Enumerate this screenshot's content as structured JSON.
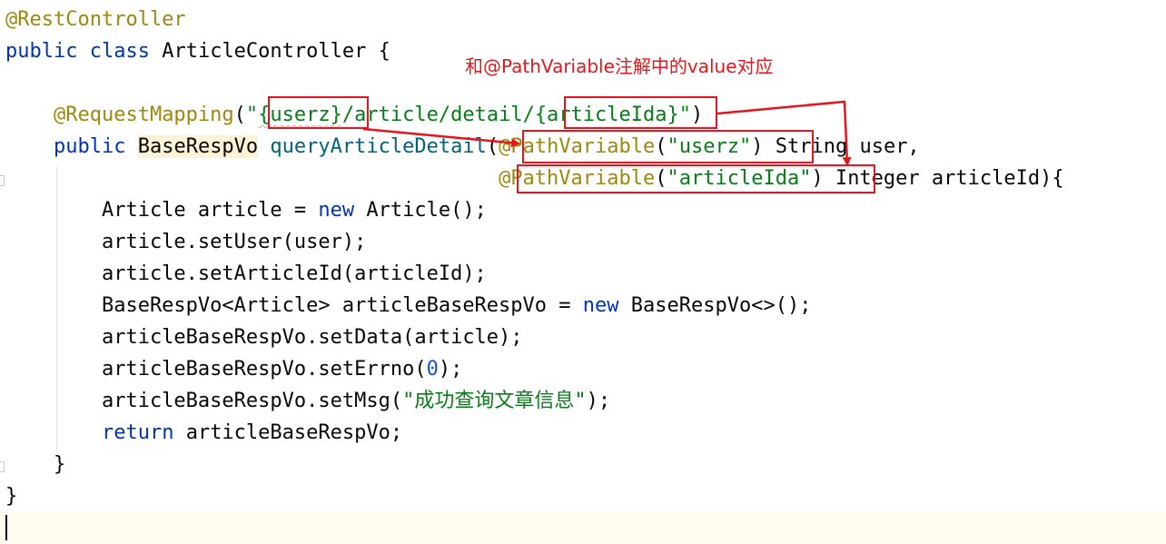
{
  "editor": {
    "lines": [
      {
        "id": "l1",
        "tokens": [
          {
            "t": "@RestController",
            "c": "ann"
          }
        ]
      },
      {
        "id": "l2",
        "tokens": [
          {
            "t": "public",
            "c": "kw"
          },
          {
            "t": " "
          },
          {
            "t": "class",
            "c": "kw"
          },
          {
            "t": " ArticleController {"
          }
        ]
      },
      {
        "id": "l3",
        "tokens": []
      },
      {
        "id": "l4",
        "tokens": [
          {
            "t": "    "
          },
          {
            "t": "@RequestMapping",
            "c": "ann"
          },
          {
            "t": "("
          },
          {
            "t": "\"",
            "c": "str"
          },
          {
            "t": "{userz}",
            "c": "str wavy"
          },
          {
            "t": "/article/detail/",
            "c": "str"
          },
          {
            "t": "{articleIda}",
            "c": "str"
          },
          {
            "t": "\"",
            "c": "str"
          },
          {
            "t": ")"
          }
        ]
      },
      {
        "id": "l5",
        "tokens": [
          {
            "t": "    "
          },
          {
            "t": "public",
            "c": "kw"
          },
          {
            "t": " "
          },
          {
            "t": "BaseRespVo",
            "c": "hl"
          },
          {
            "t": " "
          },
          {
            "t": "queryArticleDetail",
            "c": "method"
          },
          {
            "t": "("
          },
          {
            "t": "@PathVariable",
            "c": "ann"
          },
          {
            "t": "("
          },
          {
            "t": "\"userz\"",
            "c": "str"
          },
          {
            "t": ") String user,"
          }
        ]
      },
      {
        "id": "l6",
        "tokens": [
          {
            "t": "                                         "
          },
          {
            "t": "@PathVariable",
            "c": "ann"
          },
          {
            "t": "("
          },
          {
            "t": "\"articleIda\"",
            "c": "str"
          },
          {
            "t": ") Integer articleId){"
          }
        ]
      },
      {
        "id": "l7",
        "tokens": [
          {
            "t": "        Article article = "
          },
          {
            "t": "new",
            "c": "kw"
          },
          {
            "t": " Article();"
          }
        ]
      },
      {
        "id": "l8",
        "tokens": [
          {
            "t": "        article.setUser(user);"
          }
        ]
      },
      {
        "id": "l9",
        "tokens": [
          {
            "t": "        article.setArticleId(articleId);"
          }
        ]
      },
      {
        "id": "l10",
        "tokens": [
          {
            "t": "        BaseRespVo<Article> articleBaseRespVo = "
          },
          {
            "t": "new",
            "c": "kw"
          },
          {
            "t": " BaseRespVo<>();"
          }
        ]
      },
      {
        "id": "l11",
        "tokens": [
          {
            "t": "        articleBaseRespVo.setData(article);"
          }
        ]
      },
      {
        "id": "l12",
        "tokens": [
          {
            "t": "        articleBaseRespVo.setErrno("
          },
          {
            "t": "0",
            "c": "num"
          },
          {
            "t": ");"
          }
        ]
      },
      {
        "id": "l13",
        "tokens": [
          {
            "t": "        articleBaseRespVo.setMsg("
          },
          {
            "t": "\"成功查询文章信息\"",
            "c": "str"
          },
          {
            "t": ");"
          }
        ]
      },
      {
        "id": "l14",
        "tokens": [
          {
            "t": "        "
          },
          {
            "t": "return",
            "c": "kw"
          },
          {
            "t": " articleBaseRespVo;"
          }
        ]
      },
      {
        "id": "l15",
        "tokens": [
          {
            "t": "    }"
          }
        ]
      },
      {
        "id": "l16",
        "tokens": [
          {
            "t": "}"
          }
        ]
      }
    ]
  },
  "annotation": {
    "note": "和@PathVariable注解中的value对应",
    "color": "#e8141b"
  }
}
